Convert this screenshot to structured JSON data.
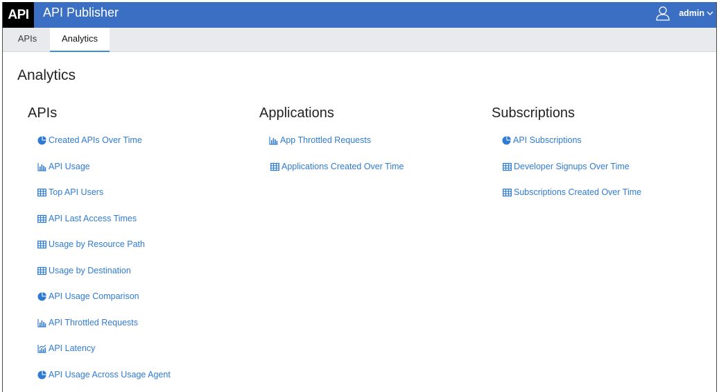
{
  "header": {
    "logo_text": "API",
    "title": "API Publisher",
    "user_name": "admin",
    "colors": {
      "bar": "#3a6fc4",
      "logo_bg": "#000000"
    },
    "icons": {
      "user": "user-icon",
      "menu": "chevron-down-icon"
    }
  },
  "tabs": [
    {
      "label": "APIs",
      "active": false
    },
    {
      "label": "Analytics",
      "active": true
    }
  ],
  "page": {
    "title": "Analytics"
  },
  "link_color": "#2f7bd1",
  "columns": [
    {
      "title": "APIs",
      "links": [
        {
          "label": "Created APIs Over Time",
          "icon": "pie-chart-icon"
        },
        {
          "label": "API Usage",
          "icon": "bar-chart-icon"
        },
        {
          "label": "Top API Users",
          "icon": "table-icon"
        },
        {
          "label": "API Last Access Times",
          "icon": "table-icon"
        },
        {
          "label": "Usage by Resource Path",
          "icon": "table-icon"
        },
        {
          "label": "Usage by Destination",
          "icon": "table-icon"
        },
        {
          "label": "API Usage Comparison",
          "icon": "pie-chart-icon"
        },
        {
          "label": "API Throttled Requests",
          "icon": "bar-chart-icon"
        },
        {
          "label": "API Latency",
          "icon": "line-chart-icon"
        },
        {
          "label": "API Usage Across Usage Agent",
          "icon": "pie-chart-icon"
        }
      ]
    },
    {
      "title": "Applications",
      "links": [
        {
          "label": "App Throttled Requests",
          "icon": "bar-chart-icon"
        },
        {
          "label": "Applications Created Over Time",
          "icon": "table-icon"
        }
      ]
    },
    {
      "title": "Subscriptions",
      "links": [
        {
          "label": "API Subscriptions",
          "icon": "pie-chart-icon"
        },
        {
          "label": "Developer Signups Over Time",
          "icon": "table-icon"
        },
        {
          "label": "Subscriptions Created Over Time",
          "icon": "table-icon"
        }
      ]
    }
  ]
}
